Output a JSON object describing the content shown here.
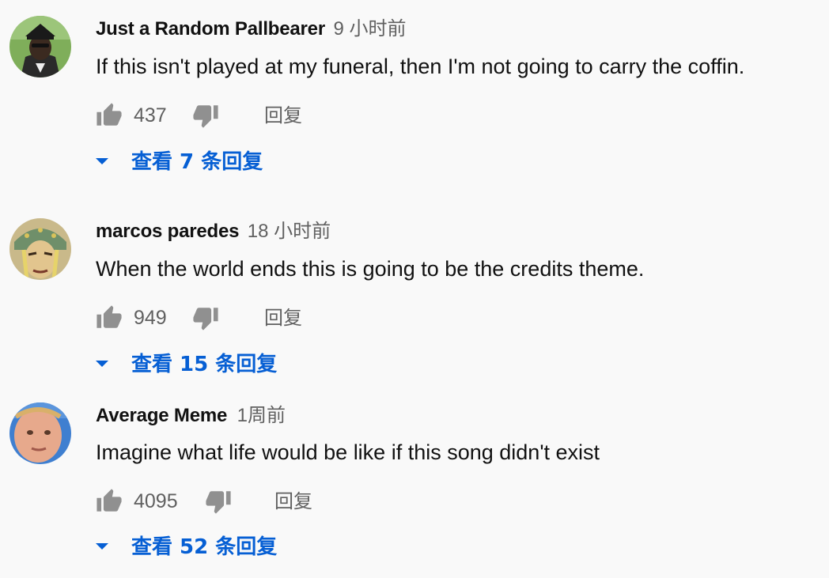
{
  "comments": [
    {
      "author": "Just a Random Pallbearer",
      "time": "9 小时前",
      "text": "If this isn't played at my funeral, then I'm not going to carry the coffin.",
      "likes": "437",
      "reply_label": "回复",
      "view_replies": "查看 7 条回复",
      "avatar_icon": "pallbearer-avatar"
    },
    {
      "author": "marcos paredes",
      "time": "18 小时前",
      "text": "When the world ends this is going to be the credits theme.",
      "likes": "949",
      "reply_label": "回复",
      "view_replies": "查看 15 条回复",
      "avatar_icon": "anime-character-avatar"
    },
    {
      "author": "Average Meme",
      "time": "1周前",
      "text": "Imagine what life would be like if this song didn't exist",
      "likes": "4095",
      "reply_label": "回复",
      "view_replies": "查看 52 条回复",
      "avatar_icon": "face-avatar"
    }
  ],
  "colors": {
    "background": "#f9f9f9",
    "link_blue": "#065fd4",
    "secondary_text": "#606060",
    "primary_text": "#111111"
  },
  "icons": {
    "like": "thumbs-up-icon",
    "dislike": "thumbs-down-icon",
    "expand": "caret-down-icon"
  }
}
